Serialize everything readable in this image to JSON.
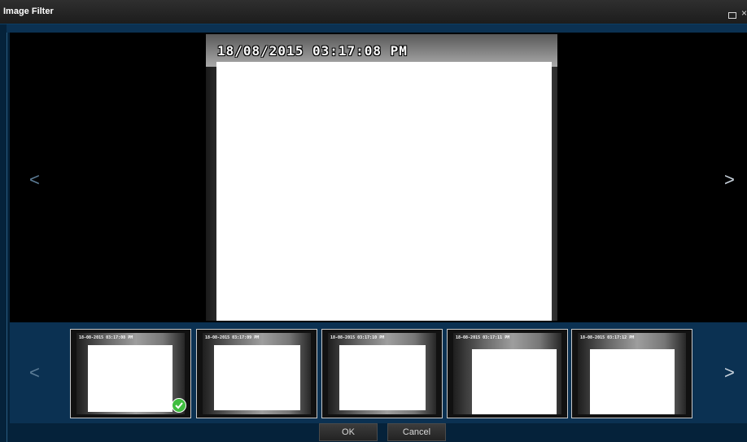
{
  "window": {
    "title": "Image Filter",
    "maximize_icon": "maximize-icon",
    "close_glyph": "×"
  },
  "viewer": {
    "prev_glyph": "<",
    "next_glyph": ">",
    "timestamp": "18/08/2015 03:17:08 PM"
  },
  "thumbnails": {
    "prev_glyph": "<",
    "next_glyph": ">",
    "items": [
      {
        "stamp": "18-08-2015 03:17:08 PM",
        "selected": true
      },
      {
        "stamp": "18-08-2015 03:17:09 PM",
        "selected": false
      },
      {
        "stamp": "18-08-2015 03:17:10 PM",
        "selected": false
      },
      {
        "stamp": "18-08-2015 03:17:11 PM",
        "selected": false
      },
      {
        "stamp": "18-08-2015 03:17:12 PM",
        "selected": false
      }
    ]
  },
  "buttons": {
    "ok": "OK",
    "cancel": "Cancel"
  },
  "colors": {
    "background": "#05223a",
    "strip": "#0b3152",
    "check": "#3fbd3f"
  }
}
